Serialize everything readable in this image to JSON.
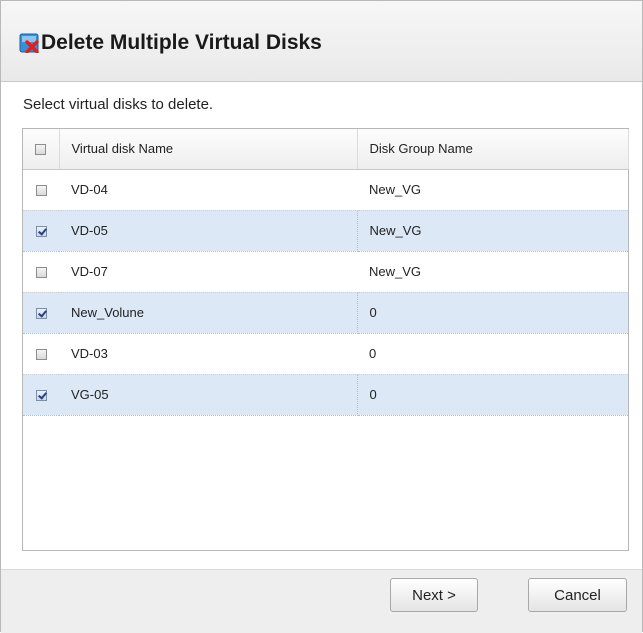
{
  "dialog": {
    "title": "Delete Multiple Virtual Disks",
    "title_icon": "delete-virtual-disk-icon",
    "instruction": "Select virtual disks to delete."
  },
  "table": {
    "columns": [
      "Virtual disk Name",
      "Disk Group Name"
    ],
    "header_checked": false,
    "rows": [
      {
        "name": "VD-04",
        "group": "New_VG",
        "checked": false
      },
      {
        "name": "VD-05",
        "group": "New_VG",
        "checked": true
      },
      {
        "name": "VD-07",
        "group": "New_VG",
        "checked": false
      },
      {
        "name": "New_Volune",
        "group": "0",
        "checked": true
      },
      {
        "name": "VD-03",
        "group": "0",
        "checked": false
      },
      {
        "name": "VG-05",
        "group": "0",
        "checked": true
      }
    ]
  },
  "buttons": {
    "next": "Next >",
    "cancel": "Cancel"
  },
  "colors": {
    "selected_row": "#dde8f6",
    "header_bg": "#eeeeee",
    "delete_x": "#e0201c",
    "disk_icon": "#3a8fd6"
  }
}
